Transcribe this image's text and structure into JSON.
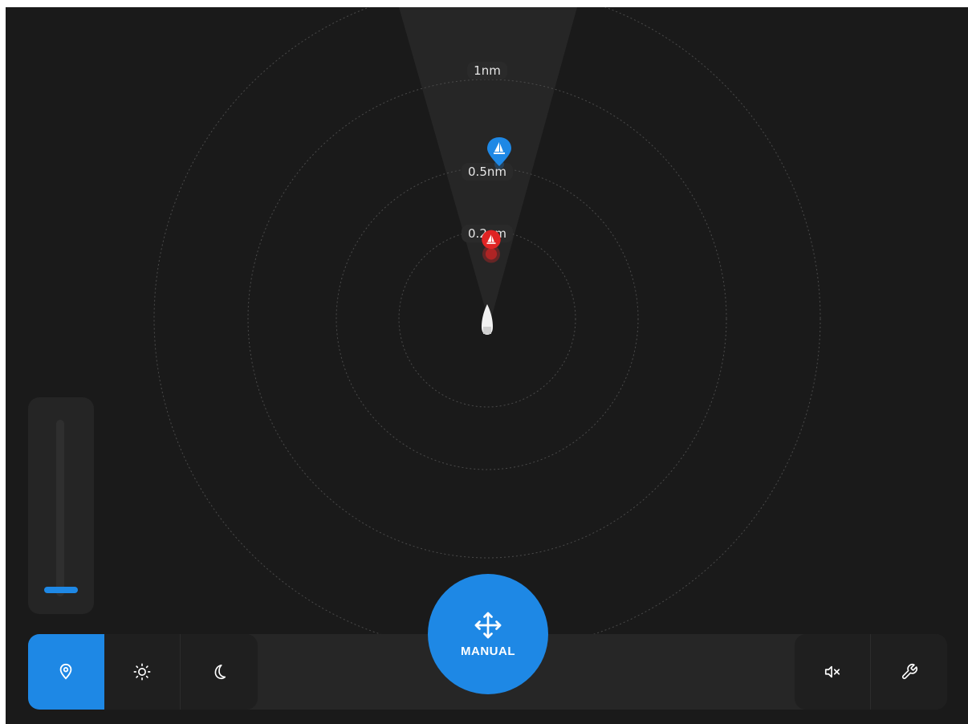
{
  "radar": {
    "ring_labels": [
      "1nm",
      "0.5nm",
      "0.2nm"
    ],
    "colors": {
      "background": "#1a1a1a",
      "ring": "#4a4a4a",
      "sector": "#2a2a2a",
      "accent": "#1e88e5",
      "danger": "#e02424"
    },
    "targets": [
      {
        "icon": "sailboat-icon",
        "color": "#1e88e5"
      },
      {
        "icon": "sailboat-icon",
        "color": "#e02424"
      }
    ]
  },
  "zoom_slider": {
    "level": 0.0
  },
  "toolbar": {
    "left_buttons": [
      {
        "icon": "location-pin-icon",
        "active": true
      },
      {
        "icon": "sun-icon",
        "active": false
      },
      {
        "icon": "moon-icon",
        "active": false
      }
    ],
    "right_buttons": [
      {
        "icon": "mute-icon"
      },
      {
        "icon": "wrench-icon"
      }
    ]
  },
  "mode_button": {
    "label": "MANUAL",
    "icon": "move-arrows-icon"
  }
}
